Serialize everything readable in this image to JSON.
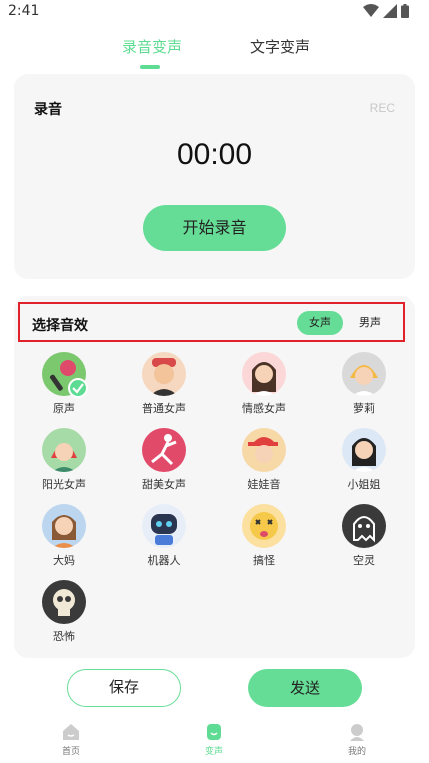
{
  "status_bar": {
    "time": "2:41"
  },
  "tabs": [
    {
      "label": "录音变声",
      "active": true
    },
    {
      "label": "文字变声",
      "active": false
    }
  ],
  "recorder": {
    "title": "录音",
    "tag": "REC",
    "timer": "00:00",
    "start_label": "开始录音"
  },
  "effects": {
    "title": "选择音效",
    "gender_options": [
      "女声",
      "男声"
    ],
    "selected_gender": "女声",
    "items": [
      {
        "label": "原声",
        "icon": "microphone-avatar-icon",
        "selected": true
      },
      {
        "label": "普通女声",
        "icon": "girl-avatar-icon"
      },
      {
        "label": "情感女声",
        "icon": "woman-avatar-icon"
      },
      {
        "label": "萝莉",
        "icon": "little-girl-avatar-icon"
      },
      {
        "label": "阳光女声",
        "icon": "sunny-girl-avatar-icon"
      },
      {
        "label": "甜美女声",
        "icon": "dancer-avatar-icon"
      },
      {
        "label": "娃娃音",
        "icon": "doll-avatar-icon"
      },
      {
        "label": "小姐姐",
        "icon": "young-lady-avatar-icon"
      },
      {
        "label": "大妈",
        "icon": "auntie-avatar-icon"
      },
      {
        "label": "机器人",
        "icon": "robot-avatar-icon"
      },
      {
        "label": "搞怪",
        "icon": "silly-face-avatar-icon"
      },
      {
        "label": "空灵",
        "icon": "ghost-avatar-icon"
      },
      {
        "label": "恐怖",
        "icon": "skull-avatar-icon"
      }
    ]
  },
  "actions": {
    "save_label": "保存",
    "send_label": "发送"
  },
  "nav": [
    {
      "label": "首页",
      "icon": "home-icon",
      "active": false
    },
    {
      "label": "变声",
      "icon": "voice-change-icon",
      "active": true
    },
    {
      "label": "我的",
      "icon": "profile-icon",
      "active": false
    }
  ],
  "colors": {
    "accent": "#66dd96",
    "highlight_border": "#e0222a",
    "card_bg": "#f6f6f6"
  }
}
